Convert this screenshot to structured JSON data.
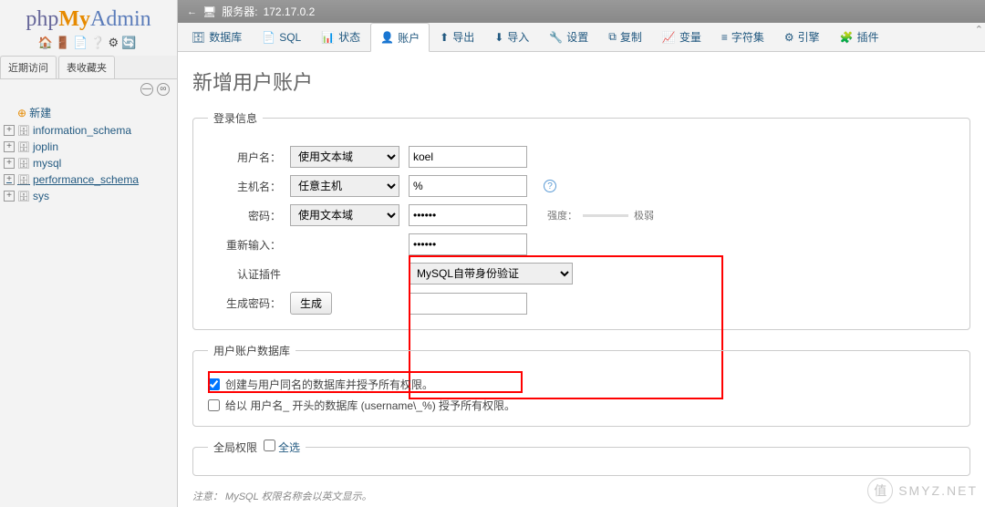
{
  "logo": {
    "p1": "php",
    "p2": "My",
    "p3": "Admin"
  },
  "sidebar_tabs": {
    "recent": "近期访问",
    "favorites": "表收藏夹"
  },
  "tree": {
    "new": "新建",
    "dbs": [
      "information_schema",
      "joplin",
      "mysql",
      "performance_schema",
      "sys"
    ]
  },
  "topbar": {
    "server_label": "服务器:",
    "server_value": "172.17.0.2"
  },
  "nav": [
    {
      "icon": "🗄",
      "label": "数据库"
    },
    {
      "icon": "📄",
      "label": "SQL"
    },
    {
      "icon": "📊",
      "label": "状态"
    },
    {
      "icon": "👤",
      "label": "账户"
    },
    {
      "icon": "⬆",
      "label": "导出"
    },
    {
      "icon": "⬇",
      "label": "导入"
    },
    {
      "icon": "🔧",
      "label": "设置"
    },
    {
      "icon": "⧉",
      "label": "复制"
    },
    {
      "icon": "📈",
      "label": "变量"
    },
    {
      "icon": "≡",
      "label": "字符集"
    },
    {
      "icon": "⚙",
      "label": "引擎"
    },
    {
      "icon": "🧩",
      "label": "插件"
    }
  ],
  "page_title": "新增用户账户",
  "fieldset1": {
    "legend": "登录信息",
    "username": {
      "label": "用户名：",
      "mode": "使用文本域",
      "value": "koel"
    },
    "hostname": {
      "label": "主机名：",
      "mode": "任意主机",
      "value": "%"
    },
    "password": {
      "label": "密码：",
      "mode": "使用文本域",
      "value": "••••••",
      "strength_label": "强度：",
      "strength_value": "极弱"
    },
    "retype": {
      "label": "重新输入：",
      "value": "••••••"
    },
    "auth": {
      "label": "认证插件",
      "value": "MySQL自带身份验证"
    },
    "gen": {
      "label": "生成密码：",
      "button": "生成",
      "value": ""
    }
  },
  "fieldset2": {
    "legend": "用户账户数据库",
    "opt1": "创建与用户同名的数据库并授予所有权限。",
    "opt2": "给以 用户名_ 开头的数据库 (username\\_%) 授予所有权限。"
  },
  "fieldset3": {
    "legend": "全局权限",
    "select_all": "全选"
  },
  "note": "注意： MySQL 权限名称会以英文显示。",
  "watermark": {
    "text": "SMYZ.NET",
    "badge": "值"
  }
}
